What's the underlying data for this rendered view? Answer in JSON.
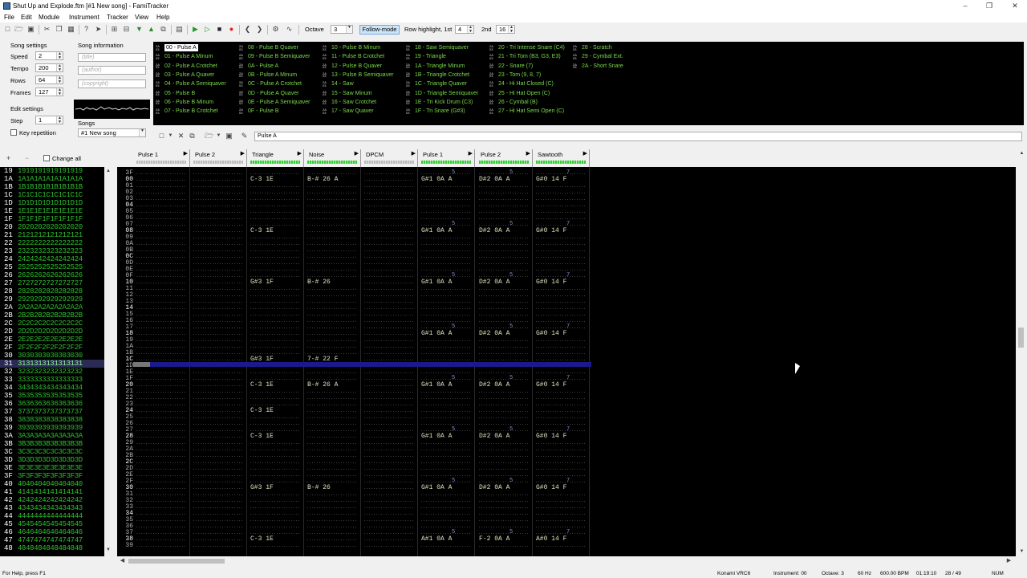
{
  "window": {
    "title": "Shut Up and Explode.ftm [#1 New song] - FamiTracker"
  },
  "menu": [
    "File",
    "Edit",
    "Module",
    "Instrument",
    "Tracker",
    "View",
    "Help"
  ],
  "toolbar": {
    "octave_label": "Octave",
    "octave_value": "3",
    "follow_mode": "Follow-mode",
    "row_hl_label": "Row highlight, 1st",
    "row_hl_1st": "4",
    "row_hl_2nd_label": "2nd",
    "row_hl_2nd": "16"
  },
  "song_settings": {
    "label": "Song settings",
    "speed_label": "Speed",
    "speed": "2",
    "tempo_label": "Tempo",
    "tempo": "200",
    "rows_label": "Rows",
    "rows": "64",
    "frames_label": "Frames",
    "frames": "127"
  },
  "song_info": {
    "label": "Song information",
    "title_ph": "(title)",
    "author_ph": "(author)",
    "copyright_ph": "(copyright)"
  },
  "edit_settings": {
    "label": "Edit settings",
    "step_label": "Step",
    "step": "1",
    "key_repetition": "Key repetition"
  },
  "songs": {
    "label": "Songs",
    "selected": "#1 New song"
  },
  "change_all": "Change all",
  "instrument_name": "Pulse A",
  "instruments": [
    {
      "num": "00",
      "name": "00 - Pulse A",
      "col": 0
    },
    {
      "num": "01",
      "name": "01 - Pulse A Minum",
      "col": 0
    },
    {
      "num": "02",
      "name": "02 - Pulse A Crotchet",
      "col": 0
    },
    {
      "num": "03",
      "name": "03 - Pulse A Quaver",
      "col": 0
    },
    {
      "num": "04",
      "name": "04 - Pulse A Semiquaver",
      "col": 0
    },
    {
      "num": "05",
      "name": "05 - Pulse B",
      "col": 0
    },
    {
      "num": "06",
      "name": "06 - Pulse B Minum",
      "col": 0
    },
    {
      "num": "07",
      "name": "07 - Pulse B Crotchet",
      "col": 0
    },
    {
      "num": "08",
      "name": "08 - Pulse B Quaver",
      "col": 1
    },
    {
      "num": "09",
      "name": "09 - Pulse B Semiquaver",
      "col": 1
    },
    {
      "num": "0A",
      "name": "0A - Pulse A",
      "col": 1
    },
    {
      "num": "0B",
      "name": "0B - Pulse A Minum",
      "col": 1
    },
    {
      "num": "0C",
      "name": "0C - Pulse A Crotchet",
      "col": 1
    },
    {
      "num": "0D",
      "name": "0D - Pulse A Quaver",
      "col": 1
    },
    {
      "num": "0E",
      "name": "0E - Pulse A Semiquaver",
      "col": 1
    },
    {
      "num": "0F",
      "name": "0F - Pulse B",
      "col": 1
    },
    {
      "num": "10",
      "name": "10 - Pulse B Minum",
      "col": 2
    },
    {
      "num": "11",
      "name": "11 - Pulse B Crotchet",
      "col": 2
    },
    {
      "num": "12",
      "name": "12 - Pulse B Quaver",
      "col": 2
    },
    {
      "num": "13",
      "name": "13 - Pulse B Semiquaver",
      "col": 2
    },
    {
      "num": "14",
      "name": "14 - Saw",
      "col": 2
    },
    {
      "num": "15",
      "name": "15 - Saw Minum",
      "col": 2
    },
    {
      "num": "16",
      "name": "16 - Saw Crotchet",
      "col": 2
    },
    {
      "num": "17",
      "name": "17 - Saw Quaver",
      "col": 2
    },
    {
      "num": "18",
      "name": "18 - Saw Semiquaver",
      "col": 3
    },
    {
      "num": "19",
      "name": "19 - Triangle",
      "col": 3
    },
    {
      "num": "1A",
      "name": "1A - Triangle Minum",
      "col": 3
    },
    {
      "num": "1B",
      "name": "1B - Triangle Crotchet",
      "col": 3
    },
    {
      "num": "1C",
      "name": "1C - Triangle Quaver",
      "col": 3
    },
    {
      "num": "1D",
      "name": "1D - Triangle Semiquaver",
      "col": 3
    },
    {
      "num": "1E",
      "name": "1E - Tri Kick Drum (C3)",
      "col": 3
    },
    {
      "num": "1F",
      "name": "1F - Tri Snare (G#3)",
      "col": 3
    },
    {
      "num": "20",
      "name": "20 - Tri Intense Snare (C4)",
      "col": 4
    },
    {
      "num": "21",
      "name": "21 - Tri Tom (B3, G3, E3)",
      "col": 4
    },
    {
      "num": "22",
      "name": "22 - Snare (7)",
      "col": 4
    },
    {
      "num": "23",
      "name": "23 - Tom (9, 8, 7)",
      "col": 4
    },
    {
      "num": "24",
      "name": "24 - Hi Hat Closed (C)",
      "col": 4
    },
    {
      "num": "25",
      "name": "25 - Hi Hat Open (C)",
      "col": 4
    },
    {
      "num": "26",
      "name": "26 - Cymbal (B)",
      "col": 4
    },
    {
      "num": "27",
      "name": "27 - Hi Hat Semi Open (C)",
      "col": 4
    },
    {
      "num": "28",
      "name": "28 - Scratch",
      "col": 5
    },
    {
      "num": "29",
      "name": "29 - Cymbal Ext.",
      "col": 5
    },
    {
      "num": "2A",
      "name": "2A - Short Snare",
      "col": 5
    }
  ],
  "channels": [
    "Pulse 1",
    "Pulse 2",
    "Triangle",
    "Noise",
    "DPCM",
    "Pulse 1",
    "Pulse 2",
    "Sawtooth"
  ],
  "frames": [
    "19",
    "1A",
    "1B",
    "1C",
    "1D",
    "1E",
    "1F",
    "20",
    "21",
    "22",
    "23",
    "24",
    "25",
    "26",
    "27",
    "28",
    "29",
    "2A",
    "2B",
    "2C",
    "2D",
    "2E",
    "2F",
    "30",
    "31",
    "32",
    "33",
    "34",
    "35",
    "36",
    "37",
    "38",
    "39",
    "3A",
    "3B",
    "3C",
    "3D",
    "3E",
    "3F",
    "40",
    "41",
    "42",
    "43",
    "44",
    "45",
    "46",
    "47",
    "48"
  ],
  "current_frame": "31",
  "row_numbers": [
    "3F",
    "00",
    "01",
    "02",
    "03",
    "04",
    "05",
    "06",
    "07",
    "08",
    "09",
    "0A",
    "0B",
    "0C",
    "0D",
    "0E",
    "0F",
    "10",
    "11",
    "12",
    "13",
    "14",
    "15",
    "16",
    "17",
    "18",
    "19",
    "1A",
    "1B",
    "1C",
    "1D",
    "1E",
    "1F",
    "20",
    "21",
    "22",
    "23",
    "24",
    "25",
    "26",
    "27",
    "28",
    "29",
    "2A",
    "2B",
    "2C",
    "2D",
    "2E",
    "2F",
    "30",
    "31",
    "32",
    "33",
    "34",
    "35",
    "36",
    "37",
    "38",
    "39"
  ],
  "notes": [
    {
      "row": "00",
      "ch": 2,
      "text": "C-3 1E"
    },
    {
      "row": "00",
      "ch": 3,
      "text": "B-# 26 A"
    },
    {
      "row": "00",
      "ch": 5,
      "text": "G#1 0A A"
    },
    {
      "row": "00",
      "ch": 6,
      "text": "D#2 0A A"
    },
    {
      "row": "00",
      "ch": 7,
      "text": "G#0 14 F"
    },
    {
      "row": "08",
      "ch": 2,
      "text": "C-3 1E"
    },
    {
      "row": "08",
      "ch": 5,
      "text": "G#1 0A A"
    },
    {
      "row": "08",
      "ch": 6,
      "text": "D#2 0A A"
    },
    {
      "row": "08",
      "ch": 7,
      "text": "G#0 14 F"
    },
    {
      "row": "10",
      "ch": 2,
      "text": "G#3 1F"
    },
    {
      "row": "10",
      "ch": 3,
      "text": "B-# 26"
    },
    {
      "row": "10",
      "ch": 5,
      "text": "G#1 0A A"
    },
    {
      "row": "10",
      "ch": 6,
      "text": "D#2 0A A"
    },
    {
      "row": "10",
      "ch": 7,
      "text": "G#0 14 F"
    },
    {
      "row": "18",
      "ch": 5,
      "text": "G#1 0A A"
    },
    {
      "row": "18",
      "ch": 6,
      "text": "D#2 0A A"
    },
    {
      "row": "18",
      "ch": 7,
      "text": "G#0 14 F"
    },
    {
      "row": "1C",
      "ch": 2,
      "text": "G#3 1F"
    },
    {
      "row": "1C",
      "ch": 3,
      "text": "7-# 22 F"
    },
    {
      "row": "20",
      "ch": 2,
      "text": "C-3 1E"
    },
    {
      "row": "20",
      "ch": 3,
      "text": "B-# 26 A"
    },
    {
      "row": "20",
      "ch": 5,
      "text": "G#1 0A A"
    },
    {
      "row": "20",
      "ch": 6,
      "text": "D#2 0A A"
    },
    {
      "row": "20",
      "ch": 7,
      "text": "G#0 14 F"
    },
    {
      "row": "24",
      "ch": 2,
      "text": "C-3 1E"
    },
    {
      "row": "28",
      "ch": 2,
      "text": "C-3 1E"
    },
    {
      "row": "28",
      "ch": 5,
      "text": "G#1 0A A"
    },
    {
      "row": "28",
      "ch": 6,
      "text": "D#2 0A A"
    },
    {
      "row": "28",
      "ch": 7,
      "text": "G#0 14 F"
    },
    {
      "row": "30",
      "ch": 2,
      "text": "G#3 1F"
    },
    {
      "row": "30",
      "ch": 3,
      "text": "B-# 26"
    },
    {
      "row": "30",
      "ch": 5,
      "text": "G#1 0A A"
    },
    {
      "row": "30",
      "ch": 6,
      "text": "D#2 0A A"
    },
    {
      "row": "30",
      "ch": 7,
      "text": "G#0 14 F"
    },
    {
      "row": "38",
      "ch": 2,
      "text": "C-3 1E"
    },
    {
      "row": "38",
      "ch": 5,
      "text": "A#1 0A A"
    },
    {
      "row": "38",
      "ch": 6,
      "text": "F-2 0A A"
    },
    {
      "row": "38",
      "ch": 7,
      "text": "A#0 14 F"
    }
  ],
  "status": {
    "help": "For Help, press F1",
    "chip": "Konami VRC6",
    "instrument": "Instrument: 00",
    "octave": "Octave: 3",
    "rate": "60 Hz",
    "bpm": "600.00 BPM",
    "time": "01:19:10",
    "pos": "28 / 49",
    "num": "NUM"
  }
}
